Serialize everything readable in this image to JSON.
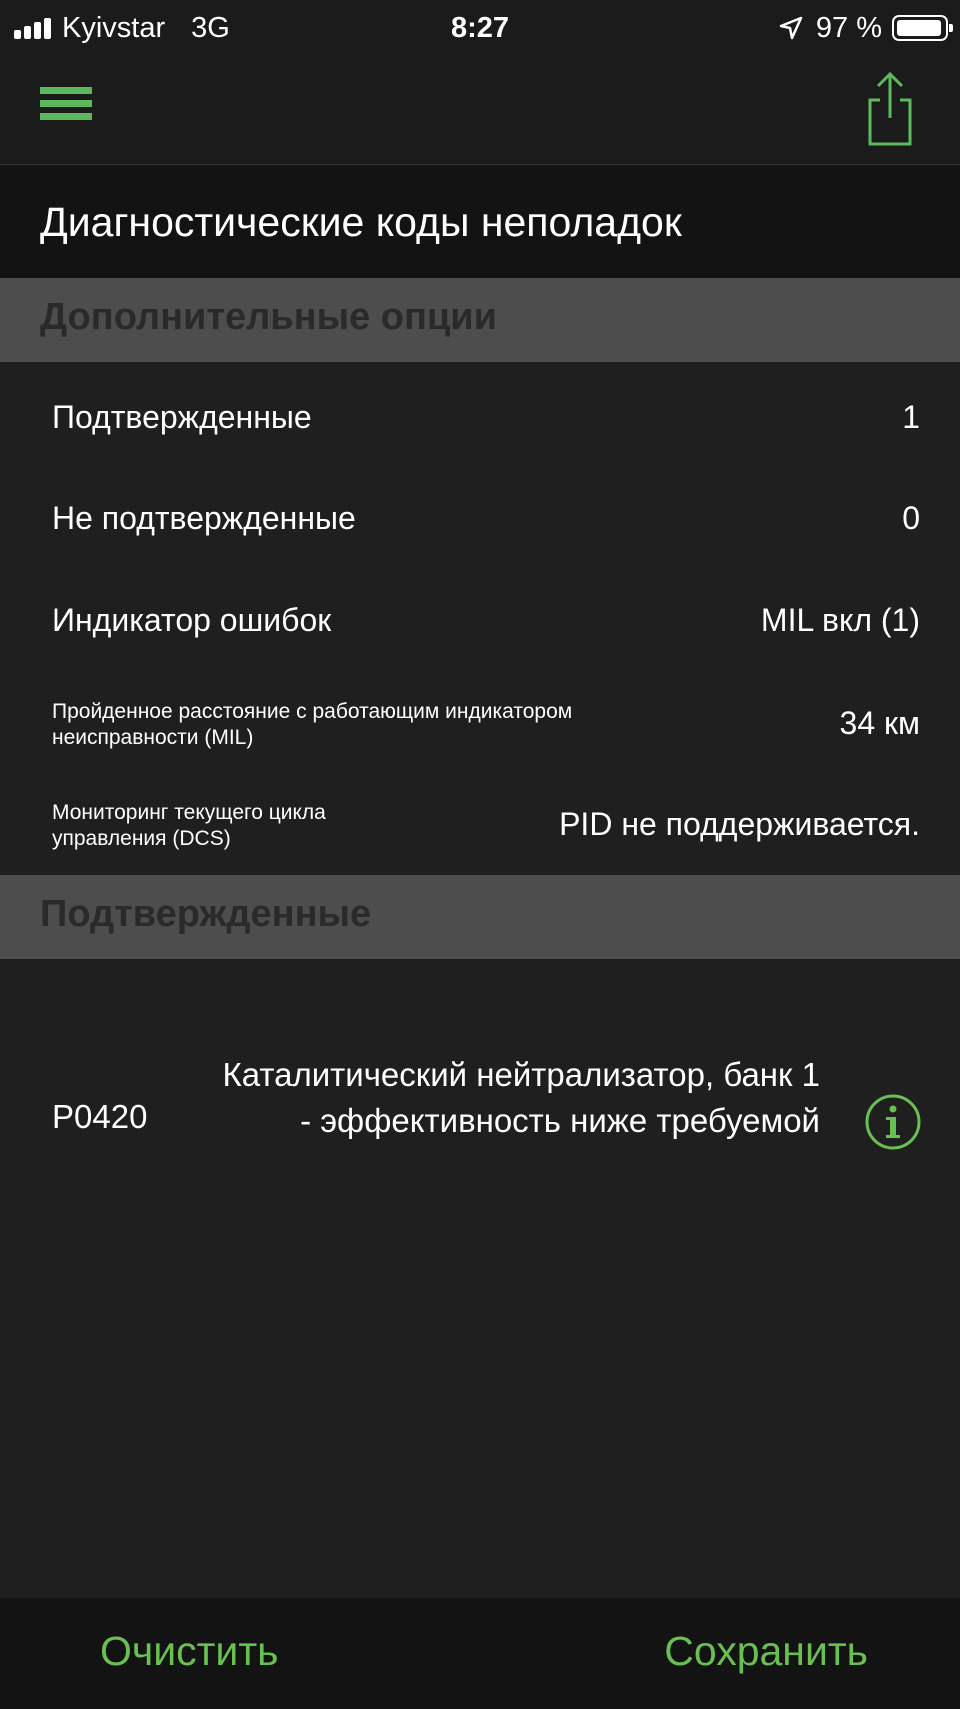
{
  "status_bar": {
    "carrier": "Kyivstar",
    "network": "3G",
    "time": "8:27",
    "battery": "97 %"
  },
  "title": "Диагностические коды неполадок",
  "sections": {
    "options_header": "Дополнительные опции",
    "confirmed_header": "Подтвержденные"
  },
  "options": [
    {
      "label": "Подтвержденные",
      "value": "1"
    },
    {
      "label": "Не подтвержденные",
      "value": "0"
    },
    {
      "label": "Индикатор ошибок",
      "value": "MIL вкл (1)"
    },
    {
      "label": "Пройденное расстояние с работающим индикатором неисправности (MIL)",
      "value": "34 км"
    },
    {
      "label": "Мониторинг текущего цикла управления (DCS)",
      "value": "PID не поддерживается."
    }
  ],
  "codes": [
    {
      "code": "P0420",
      "description": "Каталитический нейтрализатор, банк 1 - эффективность ниже требуемой"
    }
  ],
  "actions": {
    "clear": "Очистить",
    "save": "Сохранить"
  },
  "colors": {
    "accent": "#6abf52",
    "background": "#1f1f1f",
    "section_header": "#4d4d4d"
  }
}
